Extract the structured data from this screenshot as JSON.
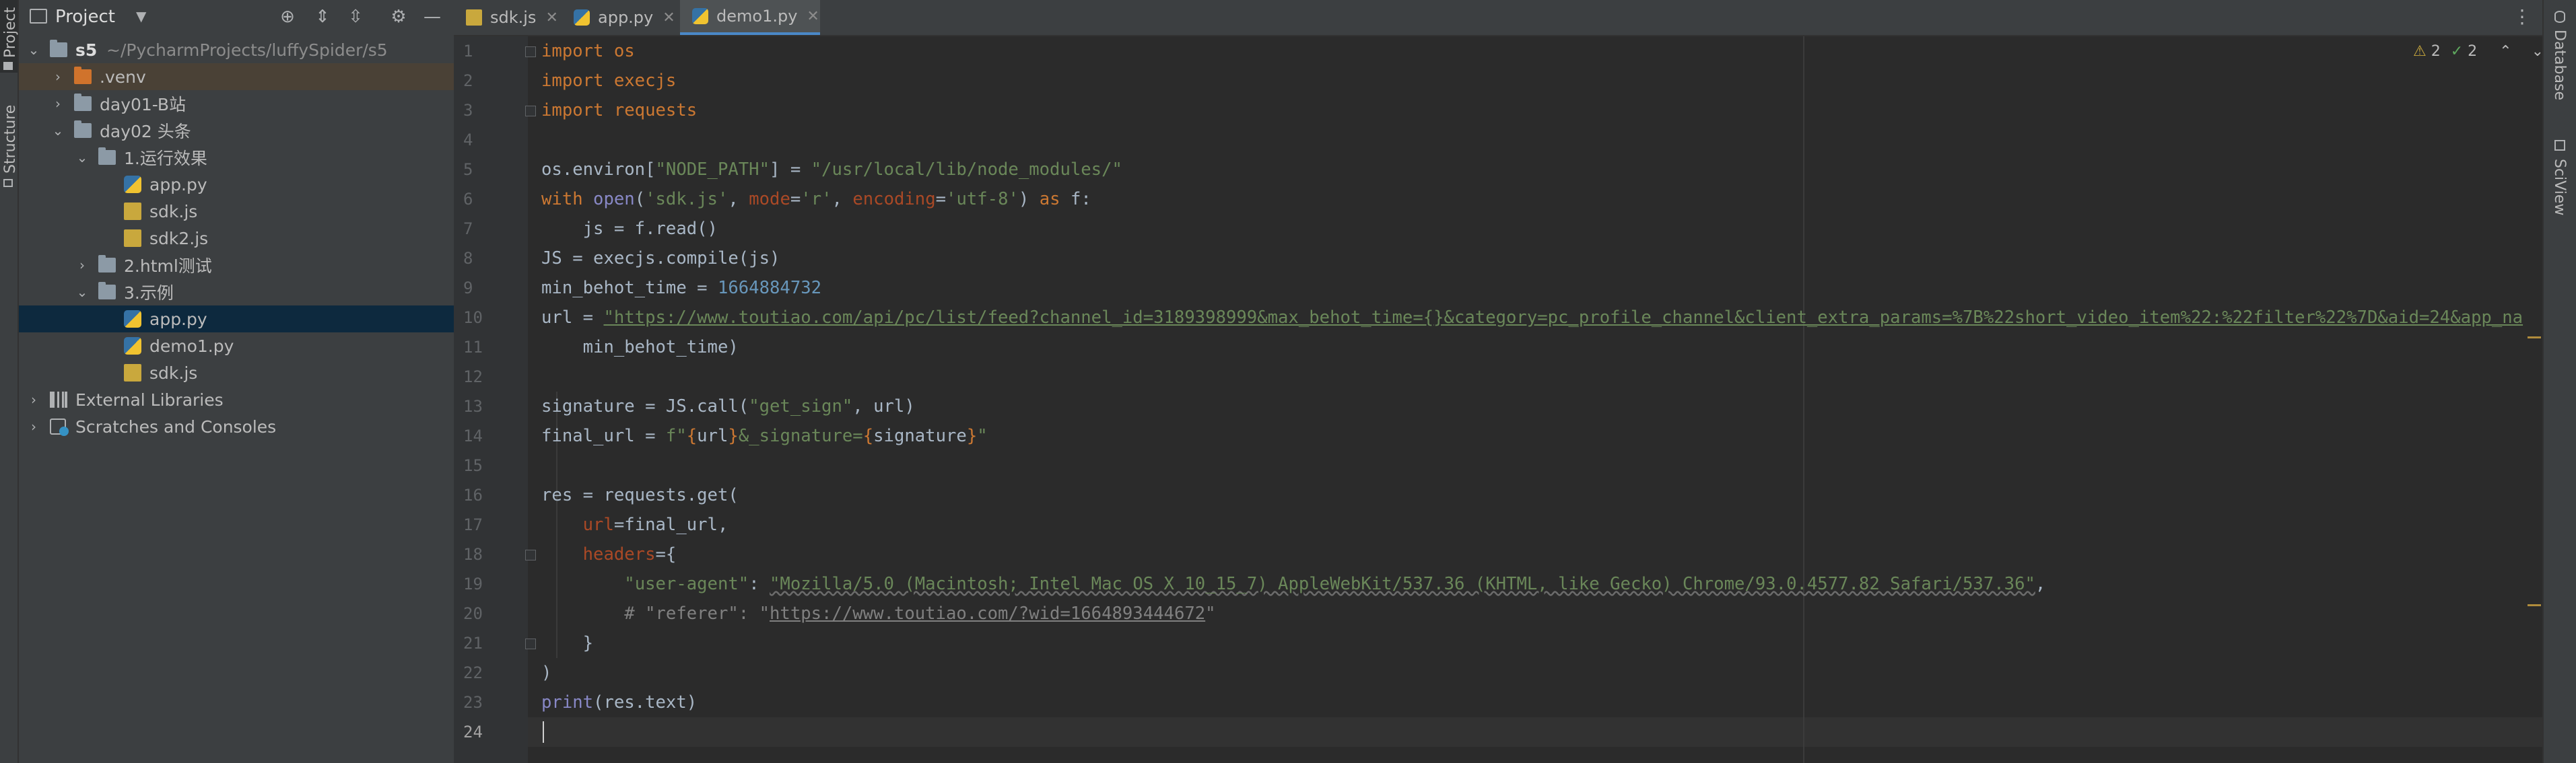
{
  "left_strip": {
    "project_label": "Project",
    "structure_label": "Structure"
  },
  "project_panel": {
    "title": "Project",
    "tree": [
      {
        "label": "s5",
        "path": "~/PycharmProjects/luffySpider/s5",
        "type": "folder",
        "expanded": true
      },
      {
        "label": ".venv",
        "type": "folder-orange",
        "expanded": false
      },
      {
        "label": "day01-B站",
        "type": "folder",
        "expanded": false
      },
      {
        "label": "day02 头条",
        "type": "folder",
        "expanded": true
      },
      {
        "label": "1.运行效果",
        "type": "folder",
        "expanded": true
      },
      {
        "label": "app.py",
        "type": "python"
      },
      {
        "label": "sdk.js",
        "type": "js"
      },
      {
        "label": "sdk2.js",
        "type": "js"
      },
      {
        "label": "2.html测试",
        "type": "folder",
        "expanded": false
      },
      {
        "label": "3.示例",
        "type": "folder",
        "expanded": true
      },
      {
        "label": "app.py",
        "type": "python",
        "selected": true
      },
      {
        "label": "demo1.py",
        "type": "python"
      },
      {
        "label": "sdk.js",
        "type": "js"
      },
      {
        "label": "External Libraries",
        "type": "library",
        "expanded": false
      },
      {
        "label": "Scratches and Consoles",
        "type": "scratch",
        "expanded": false
      }
    ]
  },
  "editor": {
    "tabs": [
      {
        "label": "sdk.js",
        "icon": "js-file-icon",
        "active": false
      },
      {
        "label": "app.py",
        "icon": "python-file-icon",
        "active": false
      },
      {
        "label": "demo1.py",
        "icon": "python-file-icon",
        "active": true
      }
    ],
    "inspection": {
      "warnings": "2",
      "checks": "2"
    },
    "line_numbers": [
      "1",
      "2",
      "3",
      "4",
      "5",
      "6",
      "7",
      "8",
      "9",
      "10",
      "11",
      "12",
      "13",
      "14",
      "15",
      "16",
      "17",
      "18",
      "19",
      "20",
      "21",
      "22",
      "23",
      "24"
    ],
    "code": {
      "l1": "import os",
      "l2": "import execjs",
      "l3": "import requests",
      "l5_a": "os.environ[",
      "l5_b": "\"NODE_PATH\"",
      "l5_c": "] = ",
      "l5_d": "\"/usr/local/lib/node_modules/\"",
      "l6_with": "with ",
      "l6_open": "open",
      "l6_a": "(",
      "l6_s1": "'sdk.js'",
      "l6_b": ", ",
      "l6_mode": "mode",
      "l6_c": "=",
      "l6_s2": "'r'",
      "l6_d": ", ",
      "l6_enc": "encoding",
      "l6_e": "=",
      "l6_s3": "'utf-8'",
      "l6_f": ") ",
      "l6_as": "as",
      "l6_g": " f:",
      "l7": "    js = f.read()",
      "l8": "JS = execjs.compile(js)",
      "l9_a": "min_behot_time = ",
      "l9_b": "1664884732",
      "l10_a": "url = ",
      "l10_b": "\"https://www.toutiao.com/api/pc/list/feed?channel_id=3189398999&max_behot_time={}&category=pc_profile_channel&client_extra_params=%7B%22short_video_item%22:%22filter%22%7D&aid=24&app_na",
      "l11": "    min_behot_time)",
      "l13_a": "signature = JS.call(",
      "l13_b": "\"get_sign\"",
      "l13_c": ", url)",
      "l14_a": "final_url = ",
      "l14_b": "f\"",
      "l14_c": "{",
      "l14_d": "url",
      "l14_e": "}",
      "l14_f": "&_signature=",
      "l14_g": "{",
      "l14_h": "signature",
      "l14_i": "}",
      "l14_j": "\"",
      "l16": "res = requests.get(",
      "l17_a": "    ",
      "l17_b": "url",
      "l17_c": "=final_url,",
      "l18_a": "    ",
      "l18_b": "headers",
      "l18_c": "={",
      "l19_a": "        ",
      "l19_b": "\"user-agent\"",
      "l19_c": ": ",
      "l19_d": "\"Mozilla/5.0 (Macintosh; Intel Mac OS X 10_15_7) AppleWebKit/537.36 (KHTML, like Gecko) Chrome/93.0.4577.82 Safari/537.36\"",
      "l19_e": ",",
      "l20_a": "        # \"referer\": \"",
      "l20_b": "https://www.toutiao.com/?wid=1664893444672",
      "l20_c": "\"",
      "l21": "    }",
      "l22": ")",
      "l23_a": "print",
      "l23_b": "(res.text)"
    }
  },
  "right_strip": {
    "database_label": "Database",
    "sciview_label": "SciView"
  }
}
